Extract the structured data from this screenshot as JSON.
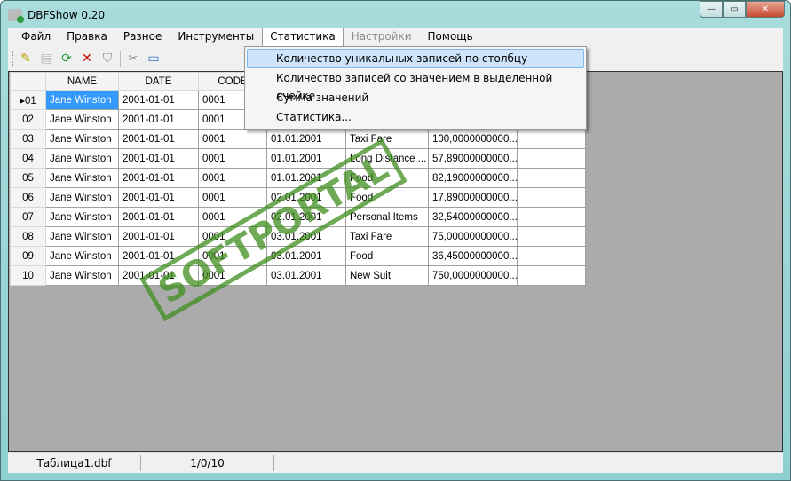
{
  "window": {
    "title": "DBFShow 0.20",
    "minimize": "—",
    "maximize": "▭",
    "close": "✕"
  },
  "menu": [
    "Файл",
    "Правка",
    "Разное",
    "Инструменты",
    "Статистика",
    "Настройки",
    "Помощь"
  ],
  "dropdown": [
    "Количество уникальных записей по столбцу",
    "Количество записей со значением в выделенной ячейке",
    "Сумма значений",
    "Статистика..."
  ],
  "toolbar": [
    {
      "name": "open-icon",
      "glyph": "✎",
      "color": "#b7a500"
    },
    {
      "name": "export-icon",
      "glyph": "▤",
      "color": "#bbbbbb"
    },
    {
      "name": "refresh-icon",
      "glyph": "⟳",
      "color": "#2a9d3a"
    },
    {
      "name": "delete-icon",
      "glyph": "✕",
      "color": "#d00000"
    },
    {
      "name": "filter-icon",
      "glyph": "⛉",
      "color": "#888888"
    },
    {
      "name": "tools-icon",
      "glyph": "✂",
      "color": "#999999"
    },
    {
      "name": "window-icon",
      "glyph": "▭",
      "color": "#2a6fc9"
    }
  ],
  "grid": {
    "headers": [
      "NAME",
      "DATE",
      "CODE",
      "",
      "",
      "",
      ""
    ],
    "rows": [
      [
        "01",
        "Jane Winston",
        "2001-01-01",
        "0001",
        "",
        "",
        "",
        ""
      ],
      [
        "02",
        "Jane Winston",
        "2001-01-01",
        "0001",
        "",
        "",
        "",
        ""
      ],
      [
        "03",
        "Jane Winston",
        "2001-01-01",
        "0001",
        "01.01.2001",
        "Taxi Fare",
        "100,0000000000...",
        ""
      ],
      [
        "04",
        "Jane Winston",
        "2001-01-01",
        "0001",
        "01.01.2001",
        "Long Distance ...",
        "57,89000000000...",
        ""
      ],
      [
        "05",
        "Jane Winston",
        "2001-01-01",
        "0001",
        "01.01.2001",
        "Food",
        "82,19000000000...",
        ""
      ],
      [
        "06",
        "Jane Winston",
        "2001-01-01",
        "0001",
        "02.01.2001",
        "Food",
        "17,89000000000...",
        ""
      ],
      [
        "07",
        "Jane Winston",
        "2001-01-01",
        "0001",
        "02.01.2001",
        "Personal Items",
        "32,54000000000...",
        ""
      ],
      [
        "08",
        "Jane Winston",
        "2001-01-01",
        "0001",
        "03.01.2001",
        "Taxi Fare",
        "75,00000000000...",
        ""
      ],
      [
        "09",
        "Jane Winston",
        "2001-01-01",
        "0001",
        "03.01.2001",
        "Food",
        "36,45000000000...",
        ""
      ],
      [
        "10",
        "Jane Winston",
        "2001-01-01",
        "0001",
        "03.01.2001",
        "New Suit",
        "750,0000000000...",
        ""
      ]
    ]
  },
  "status": {
    "file": "Таблица1.dbf",
    "position": "1/0/10"
  },
  "watermark": "SOFTPORTAL"
}
